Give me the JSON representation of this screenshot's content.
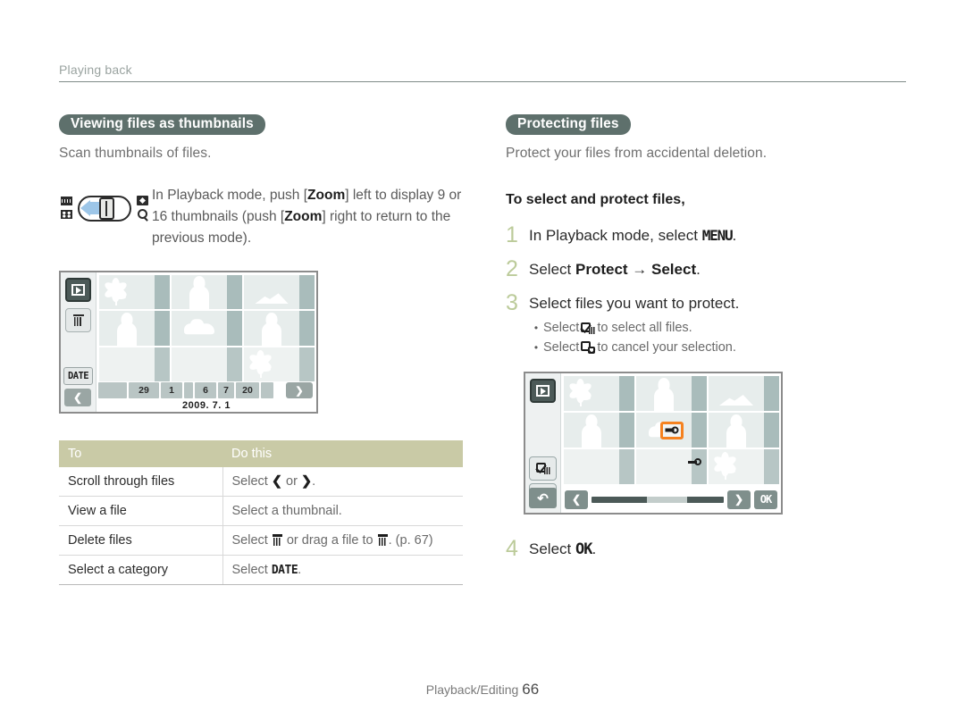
{
  "running_head": "Playing back",
  "left": {
    "heading": "Viewing files as thumbnails",
    "subtitle": "Scan thumbnails of files.",
    "note": {
      "part1": "In Playback mode, push [",
      "zoom1": "Zoom",
      "part2": "] left to display 9 or 16 thumbnails (push [",
      "zoom2": "Zoom",
      "part3": "] right to return to the previous mode)."
    },
    "screen": {
      "play_button": "play-icon",
      "delete_button": "trash-icon",
      "date_button": "DATE",
      "prev_arrow": "❮",
      "next_arrow": "❯",
      "date_cells": [
        "",
        "29",
        "1",
        "",
        "6",
        "7",
        "20",
        ""
      ],
      "date_label": "2009. 7. 1"
    },
    "table": {
      "headers": [
        "To",
        "Do this"
      ],
      "rows": [
        {
          "to": "Scroll through files",
          "do_prefix": "Select ",
          "do_icon1": "❮",
          "do_mid": " or ",
          "do_icon2": "❯",
          "do_suffix": "."
        },
        {
          "to": "View a file",
          "do_prefix": "Select a thumbnail.",
          "do_mid": "",
          "do_suffix": ""
        },
        {
          "to": "Delete files",
          "do_prefix": "Select ",
          "do_mid": " or drag a file to ",
          "do_suffix": ". (p. 67)"
        },
        {
          "to": "Select a category",
          "do_prefix": "Select ",
          "do_icon_text": "DATE",
          "do_suffix": "."
        }
      ]
    }
  },
  "right": {
    "heading": "Protecting files",
    "subtitle": "Protect your files from accidental deletion.",
    "bold_head": "To select and protect files,",
    "steps": [
      {
        "num": "1",
        "prefix": "In Playback mode, select ",
        "glyph": "MENU",
        "suffix": "."
      },
      {
        "num": "2",
        "prefix": "Select ",
        "bold1": "Protect",
        "arrow": " → ",
        "bold2": "Select",
        "suffix": "."
      },
      {
        "num": "3",
        "prefix": "Select files you want to protect.",
        "suffix": ""
      },
      {
        "num": "4",
        "prefix": "Select ",
        "glyph": "OK",
        "suffix": "."
      }
    ],
    "bullets": [
      {
        "dot": "•",
        "prefix": "Select ",
        "icon": "check-all-icon",
        "suffix": " to select all files."
      },
      {
        "dot": "•",
        "prefix": "Select ",
        "icon": "uncheck-all-icon",
        "suffix": " to cancel your selection."
      }
    ],
    "screen": {
      "play_button": "play-icon",
      "check_all_button": "check-all-icon",
      "uncheck_button": "uncheck-all-icon",
      "back_button": "↶",
      "prev_arrow": "❮",
      "next_arrow": "❯",
      "ok_button": "OK",
      "protect_badge": "key-icon"
    }
  },
  "footer": {
    "section": "Playback/Editing",
    "page": "66"
  },
  "colors": {
    "pill_bg": "#5e706c",
    "table_header_bg": "#c9caa6",
    "step_number": "#bccb9a",
    "selection_orange": "#f58220"
  }
}
